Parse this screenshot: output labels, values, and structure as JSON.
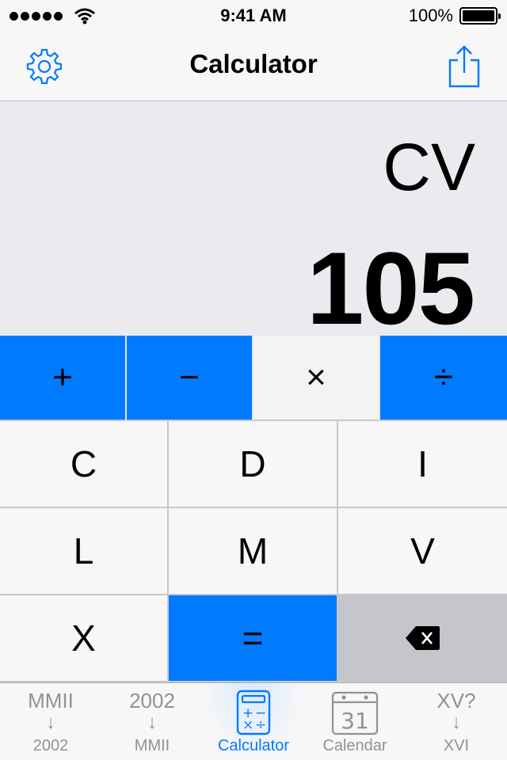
{
  "status": {
    "time": "9:41 AM",
    "battery": "100%",
    "battery_level": 1.0,
    "signal_bars": 5
  },
  "nav": {
    "title": "Calculator"
  },
  "display": {
    "roman": "CV",
    "arabic": "105"
  },
  "operators": [
    "+",
    "−",
    "×",
    "÷"
  ],
  "selected_operator": "×",
  "keys": [
    "C",
    "D",
    "I",
    "L",
    "M",
    "V",
    "X",
    "="
  ],
  "tabs": [
    {
      "top": "MMII",
      "arrow": "↓",
      "label": "2002",
      "active": false
    },
    {
      "top": "2002",
      "arrow": "↓",
      "label": "MMII",
      "active": false
    },
    {
      "icon": "calculator-icon",
      "label": "Calculator",
      "active": true
    },
    {
      "icon": "calendar-icon",
      "icon_text": "31",
      "label": "Calendar",
      "active": false
    },
    {
      "top": "XV?",
      "arrow": "↓",
      "label": "XVI",
      "active": false
    }
  ],
  "colors": {
    "accent": "#007aff",
    "display_bg": "#ebebef",
    "backspace_bg": "#c4c6cc"
  }
}
